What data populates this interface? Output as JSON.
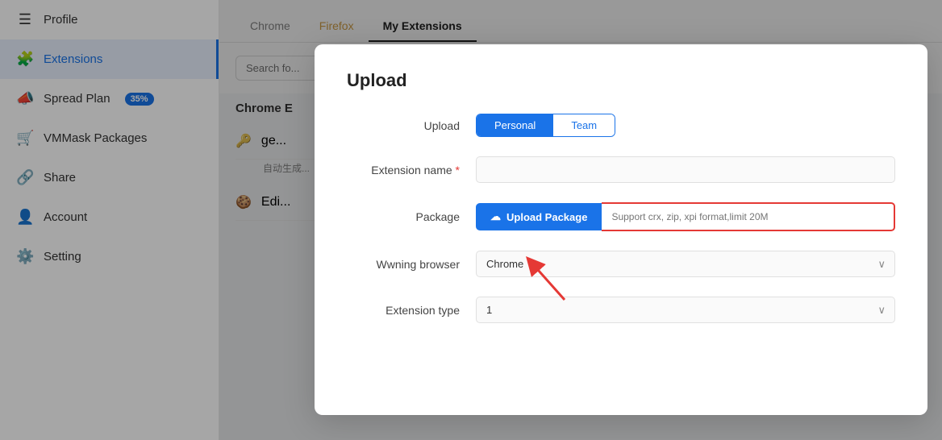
{
  "sidebar": {
    "items": [
      {
        "id": "profile",
        "label": "Profile",
        "icon": "☰",
        "active": false
      },
      {
        "id": "extensions",
        "label": "Extensions",
        "icon": "🧩",
        "active": true
      },
      {
        "id": "spread-plan",
        "label": "Spread Plan",
        "icon": "📣",
        "badge": "35%",
        "active": false
      },
      {
        "id": "vmmask-packages",
        "label": "VMMask Packages",
        "icon": "🛒",
        "active": false
      },
      {
        "id": "share",
        "label": "Share",
        "icon": "🔗",
        "active": false
      },
      {
        "id": "account",
        "label": "Account",
        "icon": "👤",
        "active": false
      },
      {
        "id": "setting",
        "label": "Setting",
        "icon": "⚙️",
        "active": false
      }
    ]
  },
  "tabs": [
    {
      "id": "chrome",
      "label": "Chrome",
      "active": false,
      "class": "chrome"
    },
    {
      "id": "firefox",
      "label": "Firefox",
      "active": false,
      "class": "firefox"
    },
    {
      "id": "my-extensions",
      "label": "My Extensions",
      "active": true,
      "class": ""
    }
  ],
  "search": {
    "placeholder": "Search fo...",
    "value": ""
  },
  "section": {
    "title": "Chrome E"
  },
  "rows": [
    {
      "icon": "🔑",
      "text": "ge...",
      "sub": "自动生成..."
    },
    {
      "icon": "🍪",
      "text": "Edi...",
      "sub": ""
    }
  ],
  "modal": {
    "title": "Upload",
    "upload_label": "Upload",
    "toggle_personal": "Personal",
    "toggle_team": "Team",
    "ext_name_label": "Extension name",
    "required_marker": "*",
    "ext_name_placeholder": "",
    "package_label": "Package",
    "upload_pkg_btn": "Upload Package",
    "pkg_placeholder": "Support crx, zip, xpi format,limit 20M",
    "wwning_label": "Wwning browser",
    "wwning_value": "Chrome",
    "ext_type_label": "Extension type",
    "ext_type_value": "1"
  }
}
